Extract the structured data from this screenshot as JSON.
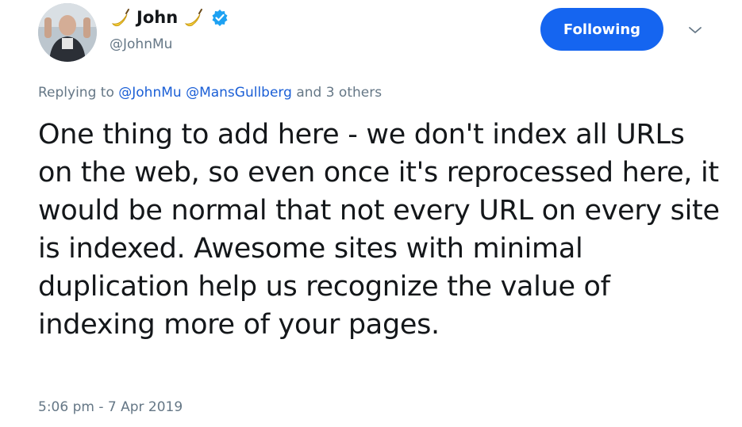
{
  "author": {
    "display_name": "John",
    "emoji_icon": "banana-icon",
    "verified_icon": "verified-badge-icon",
    "handle": "@JohnMu"
  },
  "follow_button": {
    "label": "Following"
  },
  "more_menu": {
    "icon": "chevron-down-icon"
  },
  "reply": {
    "prefix": "Replying to",
    "mentions": [
      "@JohnMu",
      "@MansGullberg"
    ],
    "suffix": "and 3 others"
  },
  "tweet": {
    "text": "One thing to add here - we don't index all URLs on the web, so even once it's reprocessed here, it would be normal that not every URL on every site is indexed. Awesome sites with minimal duplication help us recognize the value of indexing more of your pages.",
    "timestamp": "5:06 pm - 7 Apr 2019"
  },
  "colors": {
    "accent": "#1565f0",
    "mention": "#1b5fd6",
    "muted": "#657786",
    "text": "#14171a"
  }
}
